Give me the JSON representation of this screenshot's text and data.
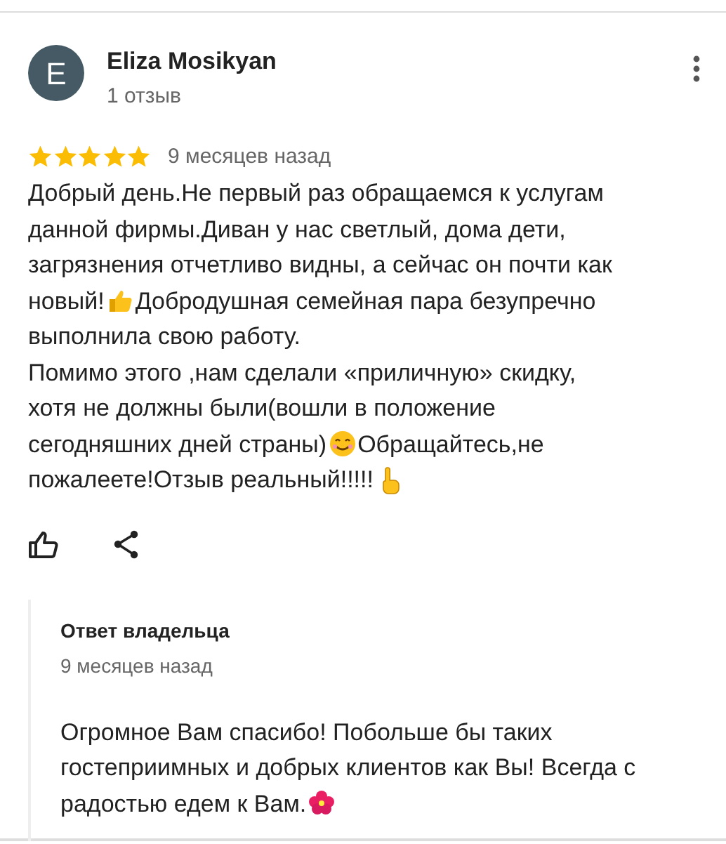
{
  "review": {
    "avatar_letter": "E",
    "author": "Eliza Mosikyan",
    "author_meta": "1 отзыв",
    "stars": 5,
    "date": "9 месяцев назад",
    "body": [
      [
        {
          "kind": "text",
          "text": "Добрый день.Не первый раз обращаемся к услугам"
        }
      ],
      [
        {
          "kind": "text",
          "text": "данной фирмы.Диван у нас светлый, дома дети,"
        }
      ],
      [
        {
          "kind": "text",
          "text": "загрязнения отчетливо видны, а сейчас он почти как"
        }
      ],
      [
        {
          "kind": "text",
          "text": "новый!"
        },
        {
          "kind": "thumb"
        },
        {
          "kind": "text",
          "text": "Добродушная семейная пара безупречно"
        }
      ],
      [
        {
          "kind": "text",
          "text": "выполнила свою работу."
        }
      ],
      [
        {
          "kind": "text",
          "text": "Помимо этого ,нам сделали «приличную» скидку,"
        }
      ],
      [
        {
          "kind": "text",
          "text": "хотя не должны были(вошли в положение"
        }
      ],
      [
        {
          "kind": "text",
          "text": "сегодняшних дней страны)"
        },
        {
          "kind": "smile"
        },
        {
          "kind": "text",
          "text": "Обращайтесь,не"
        }
      ],
      [
        {
          "kind": "text",
          "text": "пожалеете!Отзыв реальный!!!!!"
        },
        {
          "kind": "finger"
        }
      ]
    ]
  },
  "owner_reply": {
    "title": "Ответ владельца",
    "date": "9 месяцев назад",
    "body": [
      [
        {
          "kind": "text",
          "text": "Огромное Вам спасибо! Побольше бы таких"
        }
      ],
      [
        {
          "kind": "text",
          "text": "гостеприимных и добрых клиентов как Вы! Всегда с"
        }
      ],
      [
        {
          "kind": "text",
          "text": "радостью едем к Вам."
        },
        {
          "kind": "flower"
        }
      ]
    ]
  }
}
